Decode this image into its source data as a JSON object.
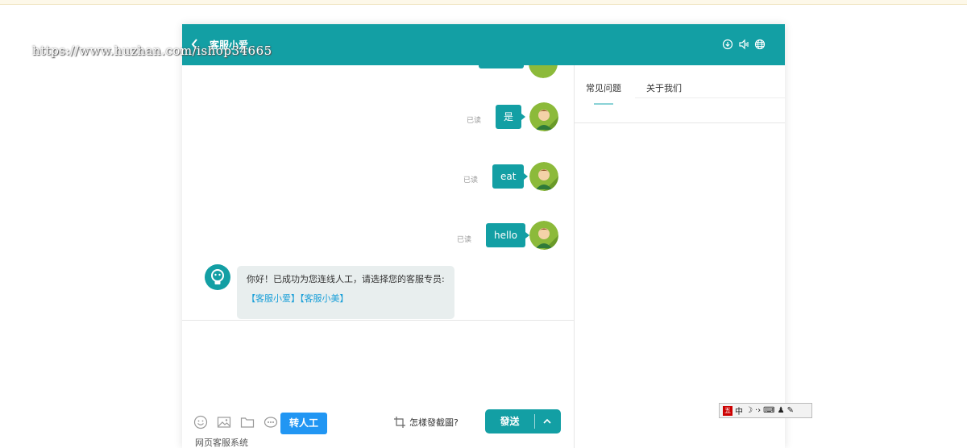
{
  "watermark": "https://www.huzhan.com/ishop34665",
  "window": {
    "title": "客服小爱",
    "header_icons": [
      "download-icon",
      "speaker-icon",
      "globe-icon"
    ]
  },
  "messages": [
    {
      "direction": "out",
      "text": "是",
      "status": "已读"
    },
    {
      "direction": "out",
      "text": "eat",
      "status": "已读"
    },
    {
      "direction": "out",
      "text": "hello",
      "status": "已读"
    },
    {
      "direction": "in",
      "text": "你好！已成功为您连线人工，请选择您的客服专员:",
      "links": [
        "【客服小爱】",
        "【客服小美】"
      ]
    }
  ],
  "composer": {
    "tool_icons": [
      "emoji-icon",
      "image-icon",
      "folder-icon",
      "evaluate-icon"
    ],
    "transfer_label": "转人工",
    "howto_label": "怎樣發截圖?",
    "send_label": "發送",
    "footer": "网页客服系统"
  },
  "side_panel": {
    "tabs": [
      "常见问题",
      "关于我们"
    ],
    "active_tab": 0
  },
  "ime_toolbar": {
    "mode": "中",
    "items": [
      "moon-icon",
      "punctuation-icon",
      "keyboard-icon",
      "user-icon",
      "wrench-icon"
    ]
  },
  "colors": {
    "primary": "#139fa4",
    "transfer_button": "#2196f3",
    "link": "#1a9fd8",
    "incoming_bubble": "#e8eeee"
  }
}
